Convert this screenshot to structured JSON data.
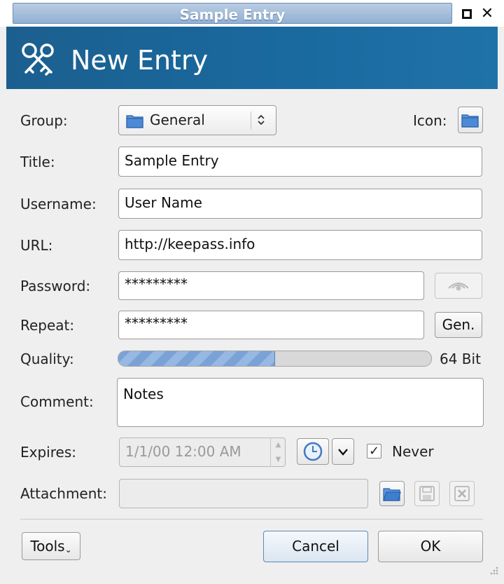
{
  "window": {
    "title": "Sample Entry"
  },
  "header": {
    "title": "New Entry",
    "icon": "keys-icon"
  },
  "form": {
    "group_label": "Group:",
    "group_value": "General",
    "icon_label": "Icon:",
    "title_label": "Title:",
    "title_value": "Sample Entry",
    "username_label": "Username:",
    "username_value": "User Name",
    "url_label": "URL:",
    "url_value": "http://keepass.info",
    "password_label": "Password:",
    "password_value": "*********",
    "repeat_label": "Repeat:",
    "repeat_value": "*********",
    "gen_label": "Gen.",
    "quality_label": "Quality:",
    "quality_percent": 50,
    "quality_text": "64 Bit",
    "comment_label": "Comment:",
    "comment_value": "Notes",
    "expires_label": "Expires:",
    "expires_value": "1/1/00 12:00 AM",
    "never_label": "Never",
    "never_checked": true,
    "attachment_label": "Attachment:",
    "attachment_value": ""
  },
  "footer": {
    "tools_label": "Tools",
    "cancel_label": "Cancel",
    "ok_label": "OK"
  },
  "colors": {
    "banner": "#1a6aa0",
    "folder": "#3d7fd0",
    "quality_fill": "#7aa2d6"
  }
}
